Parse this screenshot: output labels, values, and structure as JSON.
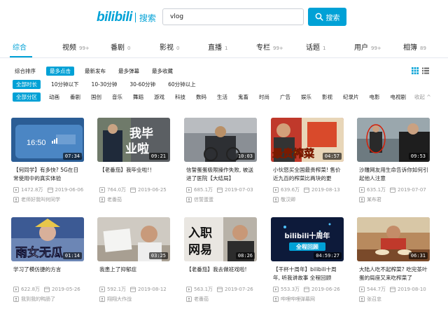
{
  "header": {
    "logo": "bilibili",
    "logo_sub": "搜索",
    "search_value": "vlog",
    "search_button": "搜索"
  },
  "tabs": [
    {
      "label": "综合",
      "count": ""
    },
    {
      "label": "视频",
      "count": "99+"
    },
    {
      "label": "番剧",
      "count": "0"
    },
    {
      "label": "影视",
      "count": "0"
    },
    {
      "label": "直播",
      "count": "1"
    },
    {
      "label": "专栏",
      "count": "99+"
    },
    {
      "label": "话题",
      "count": "1"
    },
    {
      "label": "用户",
      "count": "99+"
    },
    {
      "label": "相簿",
      "count": "89"
    }
  ],
  "filters": {
    "order": [
      "综合排序",
      "最多点击",
      "最新发布",
      "最多弹幕",
      "最多收藏"
    ],
    "duration": [
      "全部时长",
      "10分钟以下",
      "10-30分钟",
      "30-60分钟",
      "60分钟以上"
    ],
    "zones": [
      "全部分区",
      "动画",
      "番剧",
      "国创",
      "音乐",
      "舞蹈",
      "游戏",
      "科技",
      "数码",
      "生活",
      "鬼畜",
      "时尚",
      "广告",
      "娱乐",
      "影视",
      "纪录片",
      "电影",
      "电视剧"
    ],
    "fold": "收起 ^"
  },
  "videos": [
    {
      "title": "【何同学】有多快? 5G在日常使用中的真实体验",
      "views": "1472.8万",
      "date": "2019-06-06",
      "up": "老师好我叫何同学",
      "duration": "07:34"
    },
    {
      "title": "【老番茄】我毕业啦!！",
      "views": "764.0万",
      "date": "2019-06-25",
      "up": "老番茄",
      "duration": "09:21"
    },
    {
      "title": "信誓蛋蛋极限操作失败, 被送进了医院【大结局】",
      "views": "685.1万",
      "date": "2019-07-03",
      "up": "信誓蛋蛋",
      "duration": "10:03"
    },
    {
      "title": "小伙怒买全国最贵榨菜! 售价近九百的榨菜比两块的更",
      "views": "639.6万",
      "date": "2019-08-13",
      "up": "敬汉卿",
      "duration": "04:57"
    },
    {
      "title": "沙雕网友用生命告诉你如何引起他人注意",
      "views": "635.1万",
      "date": "2019-07-07",
      "up": "某布君",
      "duration": "09:53"
    },
    {
      "title": "学习了模仿捷的方言",
      "views": "622.8万",
      "date": "2019-05-26",
      "up": "我到我的鸭肠了",
      "duration": "01:14"
    },
    {
      "title": "我患上了抑郁症",
      "views": "592.1万",
      "date": "2019-08-12",
      "up": "翔翔大作战",
      "duration": "03:25"
    },
    {
      "title": "【老番茄】我去做班戏啦!",
      "views": "563.1万",
      "date": "2019-07-26",
      "up": "老番茄",
      "duration": "08:26"
    },
    {
      "title": "【干杯十周年】bilibili十周年, 听我讲故事 全程回顾",
      "views": "553.3万",
      "date": "2019-06-26",
      "up": "哔哩哔哩弹幕网",
      "duration": "04:59:27"
    },
    {
      "title": "大陆人吃不起榨菜? 吃完茶叶蛋的局座又来吃榨菜了",
      "views": "544.7万",
      "date": "2019-08-10",
      "up": "张召忠",
      "duration": "06:31"
    }
  ],
  "thumb_text": {
    "t1": "16:50",
    "t2a": "我毕",
    "t2b": "业啦",
    "t4": "最贵榨菜",
    "t6": "雨女无瓜",
    "t8a": "入职",
    "t8b": "网易",
    "t9a": "bilibili十周年",
    "t9b": "全程回顾"
  },
  "colors": {
    "accent": "#00a1d6"
  }
}
